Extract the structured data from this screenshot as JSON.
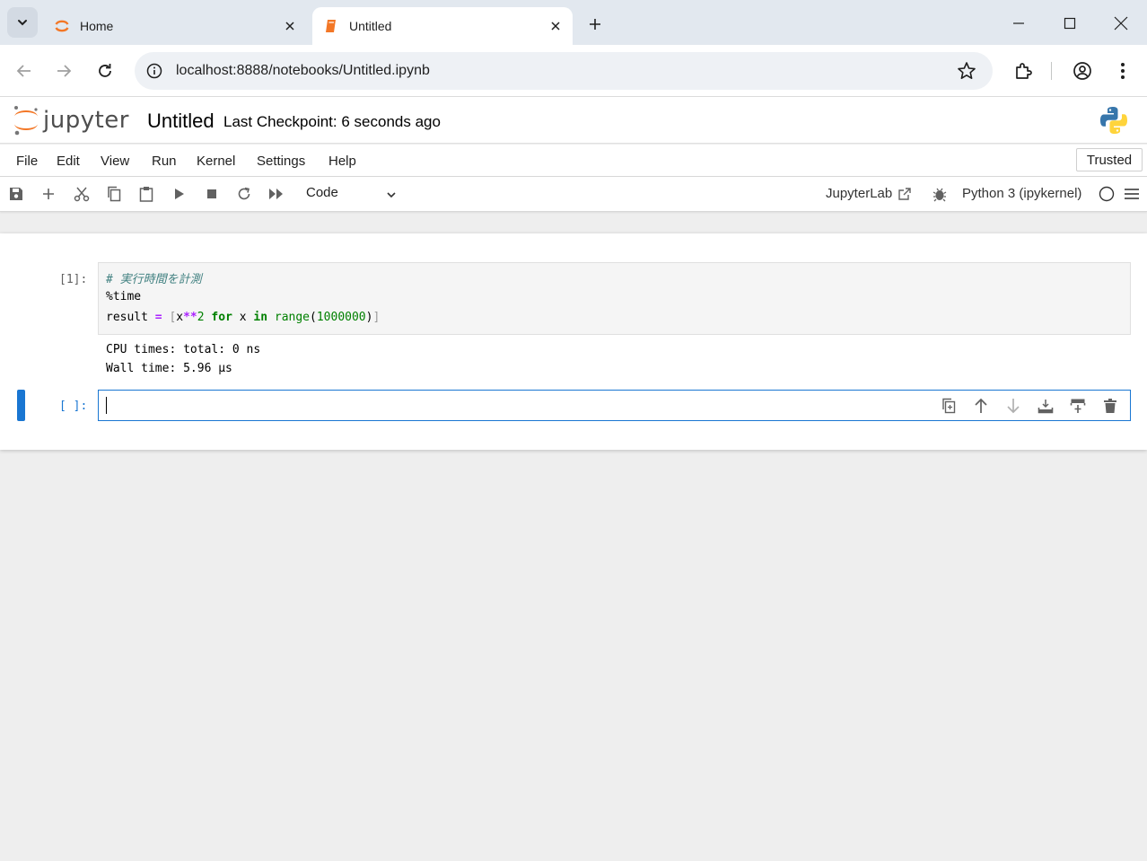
{
  "browser": {
    "tabs": [
      {
        "label": "Home"
      },
      {
        "label": "Untitled"
      }
    ],
    "url": "localhost:8888/notebooks/Untitled.ipynb"
  },
  "header": {
    "logo_text": "jupyter",
    "notebook_title": "Untitled",
    "checkpoint": "Last Checkpoint: 6 seconds ago"
  },
  "menu": {
    "items": [
      "File",
      "Edit",
      "View",
      "Run",
      "Kernel",
      "Settings",
      "Help"
    ],
    "trusted": "Trusted"
  },
  "toolbar": {
    "cell_type": "Code",
    "jupyterlab_link": "JupyterLab",
    "kernel": "Python 3 (ipykernel)"
  },
  "cells": [
    {
      "prompt": "[1]:",
      "code": {
        "line1": "# 実行時間を計測",
        "line2": "%time",
        "line3": {
          "t1": "result ",
          "t2": "=",
          "t3": " ",
          "t4": "[",
          "t5": "x",
          "t6": "**",
          "t7": "2",
          "t8": " ",
          "t9": "for",
          "t10": " x ",
          "t11": "in",
          "t12": " ",
          "t13": "range",
          "t14": "(",
          "t15": "1000000",
          "t16": ")",
          "t17": "]"
        }
      },
      "output": [
        "CPU times: total: 0 ns",
        "Wall time: 5.96 µs"
      ]
    },
    {
      "prompt": "[ ]:"
    }
  ],
  "colors": {
    "accent": "#1976d2",
    "jupyter_orange": "#f37726"
  }
}
